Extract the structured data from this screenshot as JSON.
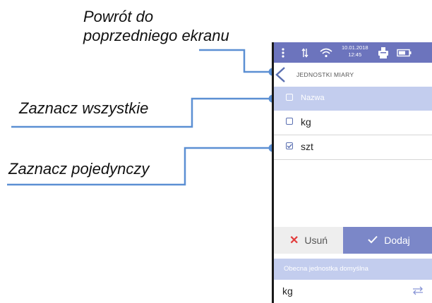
{
  "annotations": {
    "back": [
      "Powrót do",
      "poprzedniego ekranu"
    ],
    "select_all": "Zaznacz wszystkie",
    "select_single": "Zaznacz pojedynczy"
  },
  "statusbar": {
    "date": "10.01.2018",
    "time": "12:45",
    "icons": [
      "menu-dots-icon",
      "data-transfer-icon",
      "wifi-icon",
      "printer-icon",
      "battery-icon"
    ]
  },
  "screen": {
    "title": "JEDNOSTKI MIARY",
    "header_label": "Nazwa",
    "items": [
      {
        "label": "kg",
        "checked": false
      },
      {
        "label": "szt",
        "checked": true
      }
    ],
    "delete_label": "Usuń",
    "add_label": "Dodaj",
    "default_header": "Obecna jednostka domyślna",
    "default_value": "kg"
  },
  "colors": {
    "statusbar": "#6c74bd",
    "header_row": "#c3cdee",
    "add_button": "#7b87c8",
    "delete_icon": "#e23b3b",
    "leader_line": "#5b8fd3"
  }
}
